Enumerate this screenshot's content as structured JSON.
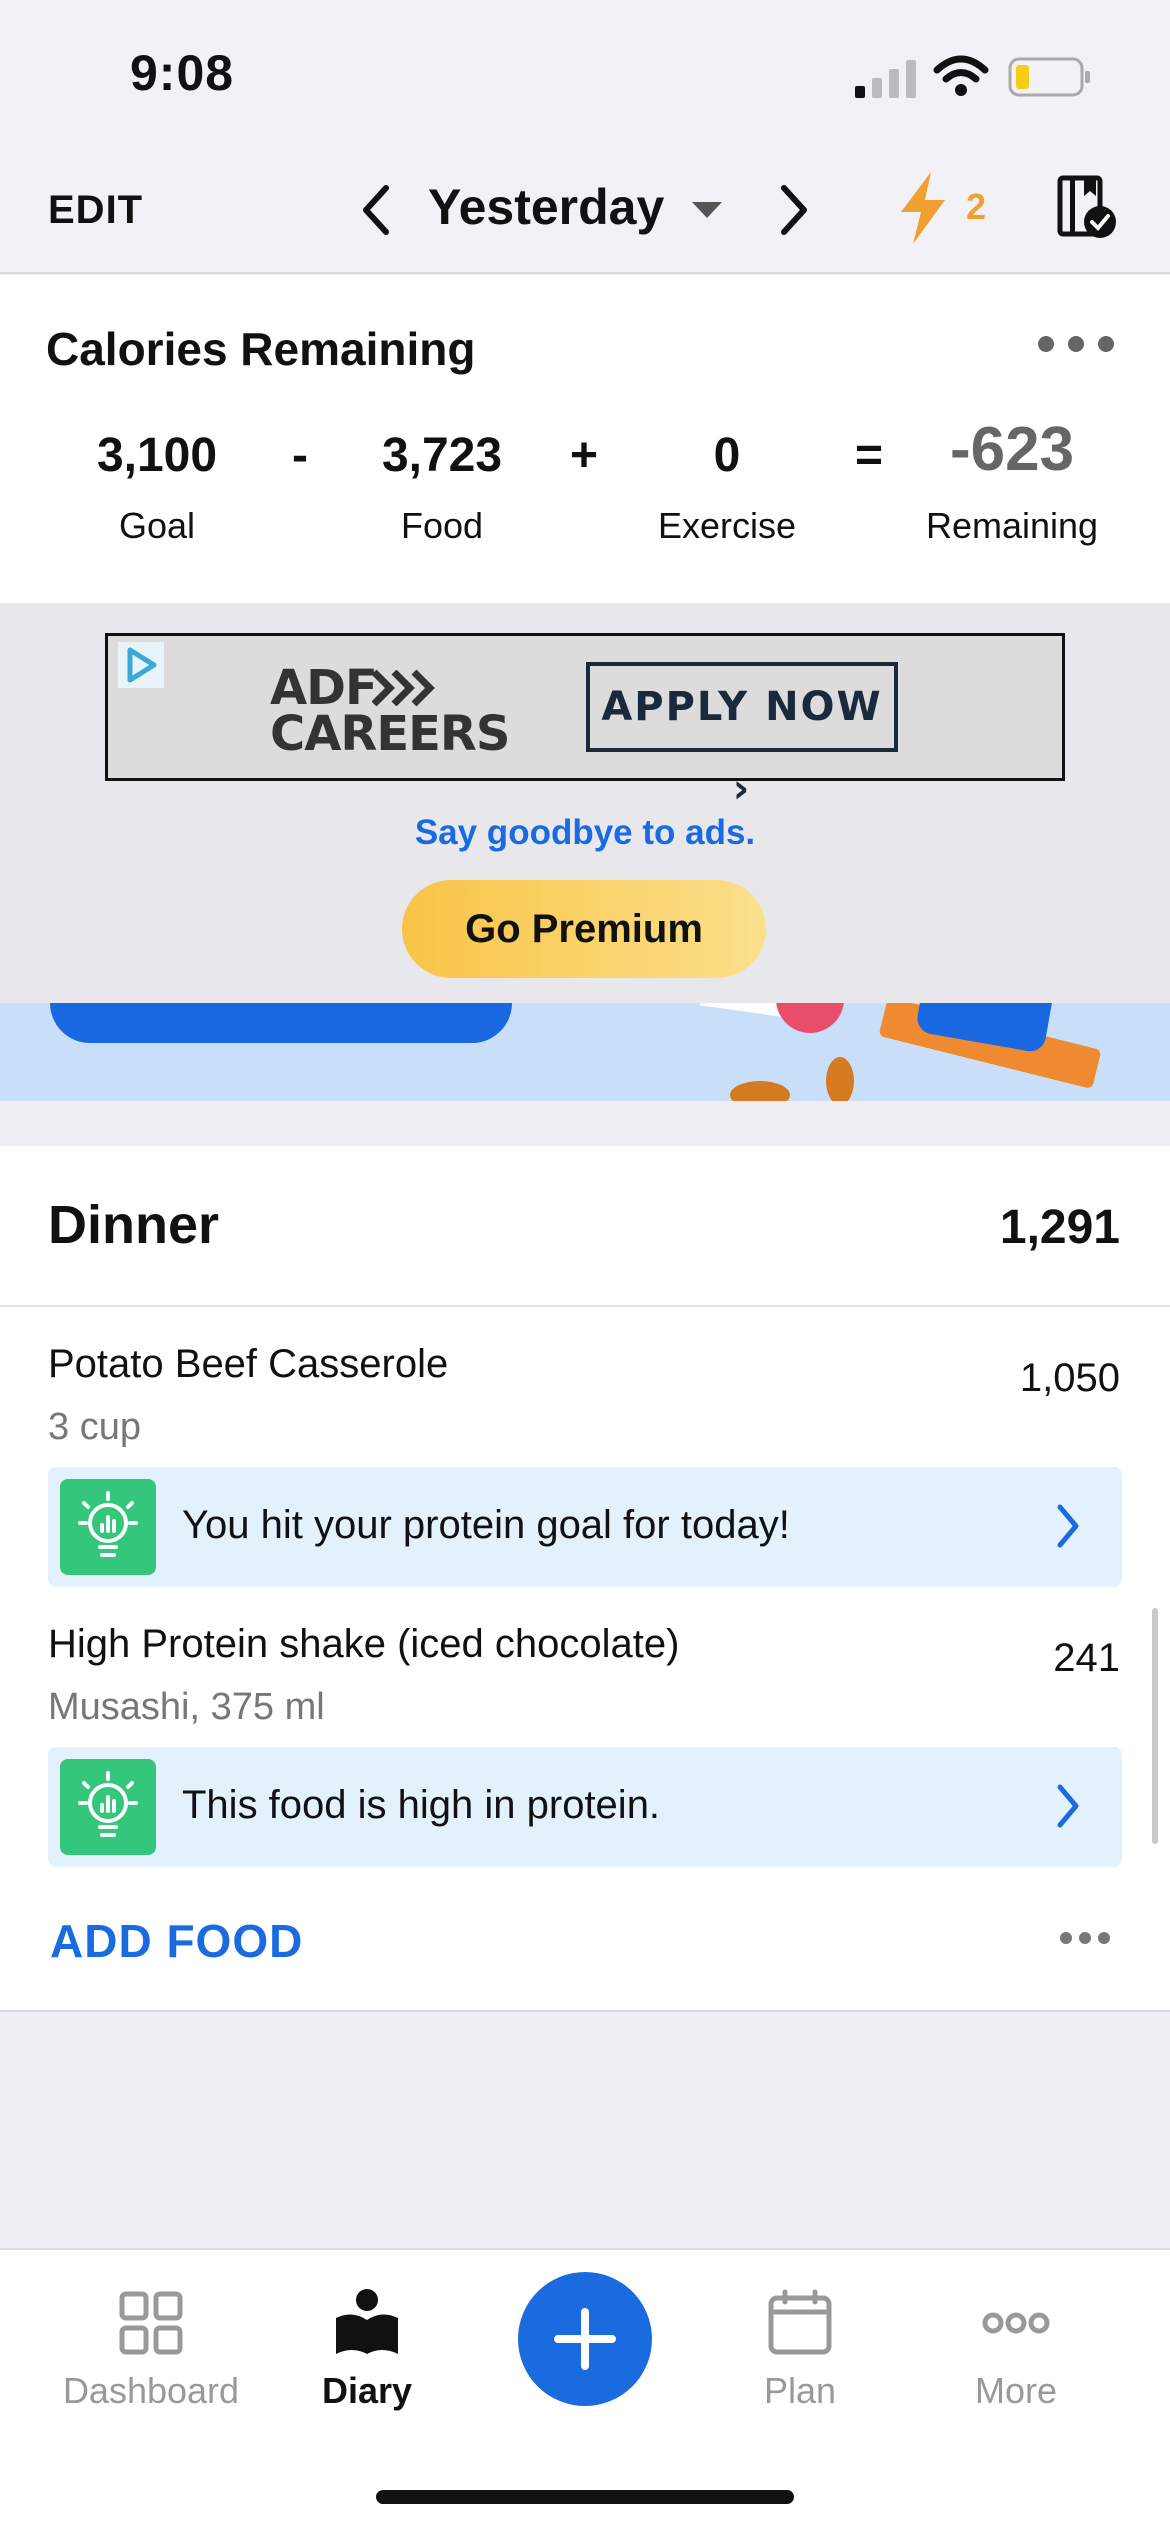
{
  "status": {
    "time": "9:08"
  },
  "nav": {
    "edit_label": "EDIT",
    "date_label": "Yesterday",
    "streak_count": "2",
    "icons": [
      "chevron-left-icon",
      "caret-down-icon",
      "chevron-right-icon",
      "lightning-icon",
      "diary-check-icon"
    ]
  },
  "calories": {
    "title": "Calories Remaining",
    "goal_value": "3,100",
    "goal_label": "Goal",
    "minus": "-",
    "food_value": "3,723",
    "food_label": "Food",
    "plus": "+",
    "exercise_value": "0",
    "exercise_label": "Exercise",
    "equals": "=",
    "remaining_value": "-623",
    "remaining_label": "Remaining"
  },
  "ad": {
    "logo_line1": "ADF",
    "logo_line2": "CAREERS",
    "cta": "APPLY NOW",
    "remove_ads_text": "Say goodbye to ads.",
    "premium_button": "Go Premium"
  },
  "dinner": {
    "title": "Dinner",
    "total": "1,291",
    "items": [
      {
        "name": "Potato Beef Casserole",
        "serving": "3 cup",
        "calories": "1,050",
        "tip": "You hit your protein goal for today!"
      },
      {
        "name": "High Protein shake (iced chocolate)",
        "serving": "Musashi, 375 ml",
        "calories": "241",
        "tip": "This food is high in protein."
      }
    ],
    "add_food": "ADD FOOD"
  },
  "tabs": [
    {
      "label": "Dashboard",
      "icon": "dashboard-icon",
      "active": false
    },
    {
      "label": "Diary",
      "icon": "diary-icon",
      "active": true
    },
    {
      "label": "Plan",
      "icon": "calendar-icon",
      "active": false
    },
    {
      "label": "More",
      "icon": "more-icon",
      "active": false
    }
  ],
  "colors": {
    "accent": "#1a6be0",
    "premium": "#f8c446",
    "tip_bg": "#e3f1fd",
    "tip_icon": "#34c77b",
    "streak": "#f0a030"
  }
}
